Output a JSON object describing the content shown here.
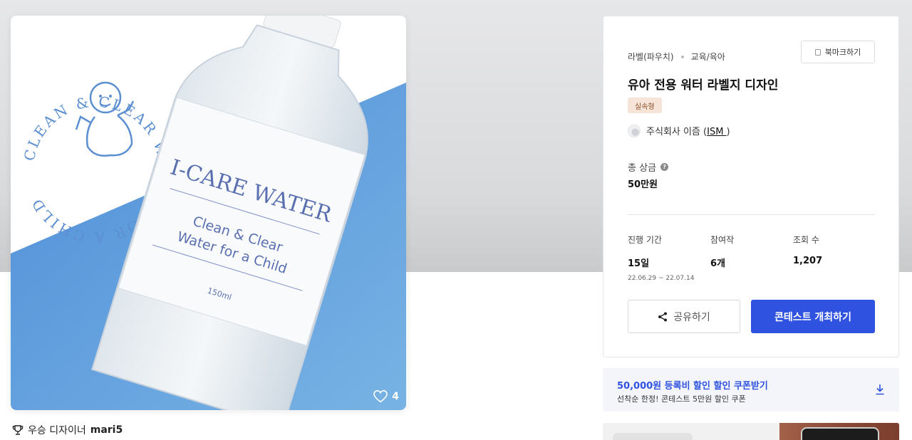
{
  "product": {
    "likes": "4",
    "logo_text": "CLEAN & CLEAR WATER FOR A CHILD",
    "label_brand": "I-CARE WATER",
    "label_tagline_1": "Clean & Clear",
    "label_tagline_2": "Water for a Child",
    "label_volume": "150ml"
  },
  "winner": {
    "label": "우승 디자이너",
    "name": "mari5"
  },
  "contest": {
    "category": "라벨(파우치)",
    "subcategory": "교육/육아",
    "bookmark_label": "북마크하기",
    "title": "유아 전용 워터 라벨지 디자인",
    "type_tag": "실속형",
    "company_name": "주식회사 이즘 (",
    "company_link": "ISM ",
    "company_close": ")",
    "prize_label": "총 상금",
    "prize_value": "50만원",
    "stats": [
      {
        "label": "진행 기간",
        "value": "15일",
        "sub": "22.06.29 ~ 22.07.14"
      },
      {
        "label": "참여작",
        "value": "6개",
        "sub": ""
      },
      {
        "label": "조회 수",
        "value": "1,207",
        "sub": ""
      }
    ],
    "share_label": "공유하기",
    "host_label": "콘테스트 개최하기"
  },
  "coupon": {
    "title": "50,000원 등록비 할인 할인 쿠폰받기",
    "subtitle": "선착순 한정! 콘테스트 5만원 할인 쿠폰"
  },
  "colors": {
    "accent": "#2f52e0",
    "logo_blue": "#5b8fd1",
    "label_text": "#5a6fb0"
  }
}
